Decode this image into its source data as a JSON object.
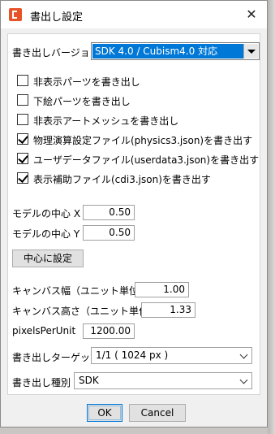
{
  "window": {
    "title": "書出し設定",
    "close_glyph": "✕",
    "app_icon": "cubism-app-icon"
  },
  "export_version": {
    "label": "書き出しバージョン",
    "selected": "SDK 4.0 / Cubism4.0 対応"
  },
  "options": [
    {
      "label": "非表示パーツを書き出し",
      "checked": false
    },
    {
      "label": "下絵パーツを書き出し",
      "checked": false
    },
    {
      "label": "非表示アートメッシュを書き出し",
      "checked": false
    },
    {
      "label": "物理演算設定ファイル(physics3.json)を書き出す",
      "checked": true
    },
    {
      "label": "ユーザデータファイル(userdata3.json)を書き出す",
      "checked": true
    },
    {
      "label": "表示補助ファイル(cdi3.json)を書き出す",
      "checked": true
    }
  ],
  "center": {
    "x_label": "モデルの中心 X",
    "x_value": "0.50",
    "y_label": "モデルの中心 Y",
    "y_value": "0.50",
    "set_center_button": "中心に設定"
  },
  "canvas": {
    "width_label": "キャンバス幅（ユニット単位)",
    "width_value": "1.00",
    "height_label": "キャンバス高さ（ユニット単位)",
    "height_value": "1.33",
    "ppu_label": "pixelsPerUnit",
    "ppu_value": "1200.00"
  },
  "export_target": {
    "label": "書き出しターゲット",
    "selected": "1/1 ( 1024 px )"
  },
  "export_type": {
    "label": "書き出し種別",
    "selected": "SDK"
  },
  "footer": {
    "ok_label": "OK",
    "cancel_label": "Cancel"
  },
  "colors": {
    "selection": "#0078d7",
    "app_icon": "#e8542a"
  }
}
